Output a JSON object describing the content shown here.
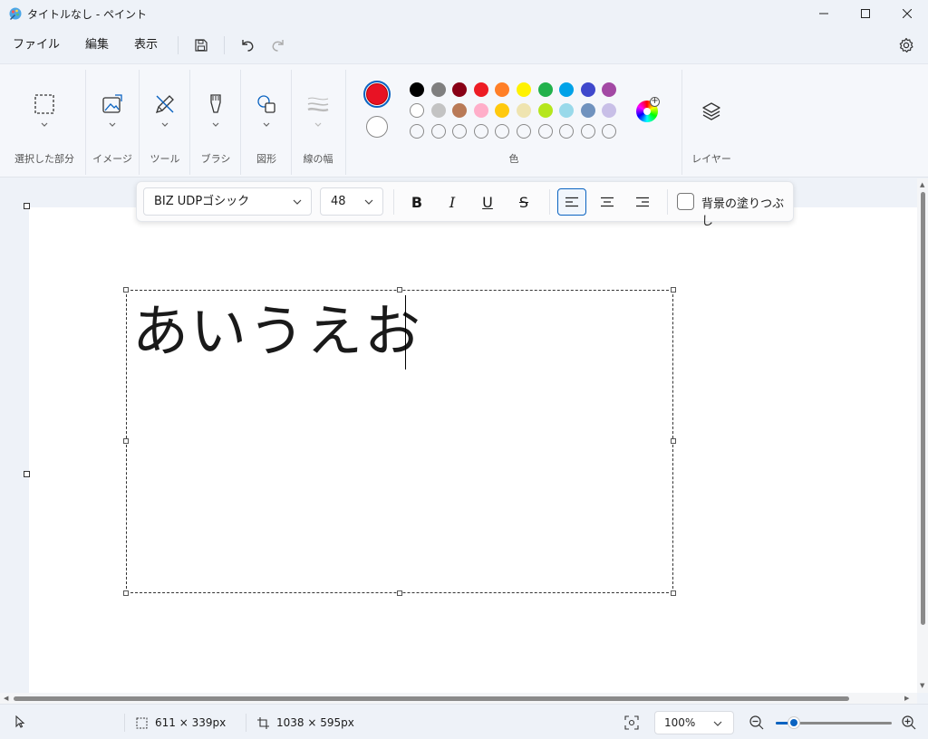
{
  "window": {
    "title": "タイトルなし - ペイント"
  },
  "menu": {
    "file": "ファイル",
    "edit": "編集",
    "view": "表示"
  },
  "ribbon": {
    "selection_label": "選択した部分",
    "image_label": "イメージ",
    "tools_label": "ツール",
    "brushes_label": "ブラシ",
    "shapes_label": "図形",
    "size_label": "線の幅",
    "colors_label": "色",
    "layers_label": "レイヤー",
    "primary_color": "#e81224",
    "secondary_color": "#ffffff",
    "palette_row1": [
      "#000000",
      "#7f7f7f",
      "#880015",
      "#ed1c24",
      "#ff7f27",
      "#fff200",
      "#22b14c",
      "#00a2e8",
      "#3f48cc",
      "#a349a4"
    ],
    "palette_row2": [
      "#ffffff",
      "#c3c3c3",
      "#b97a57",
      "#ffaec9",
      "#ffc90e",
      "#efe4b0",
      "#b5e61d",
      "#99d9ea",
      "#7092be",
      "#c8bfe7"
    ]
  },
  "text_toolbar": {
    "font": "BIZ UDPゴシック",
    "size": "48",
    "bold": "B",
    "italic": "I",
    "underline": "U",
    "strike": "S",
    "fill_background": "背景の塗りつぶし"
  },
  "canvas": {
    "text": "あいうえお"
  },
  "status": {
    "selection_size": "611 × 339px",
    "canvas_size": "1038 × 595px",
    "zoom": "100%",
    "zoom_level_percent": 100
  }
}
